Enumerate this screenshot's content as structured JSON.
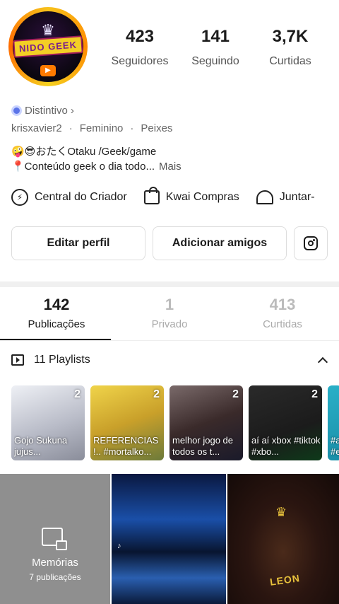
{
  "profile": {
    "avatar_logo_text": "NIDO GEEK",
    "stats": [
      {
        "value": "423",
        "label": "Seguidores"
      },
      {
        "value": "141",
        "label": "Seguindo"
      },
      {
        "value": "3,7K",
        "label": "Curtidas"
      }
    ],
    "badge_label": "Distintivo",
    "badge_chevron": "›",
    "username": "krisxavier2",
    "gender": "Feminino",
    "sign": "Peixes",
    "meta_sep": "·",
    "bio_line1": "🤪😎おたくOtaku /Geek/game",
    "bio_line2": "📍Conteúdo geek o dia todo...",
    "bio_more": "Mais"
  },
  "tools": [
    {
      "label": "Central do Criador",
      "icon": "lightning-icon"
    },
    {
      "label": "Kwai Compras",
      "icon": "shopping-bag-icon"
    },
    {
      "label": "Juntar-",
      "icon": "tent-icon"
    }
  ],
  "buttons": {
    "edit_profile": "Editar perfil",
    "add_friends": "Adicionar amigos"
  },
  "tabs": [
    {
      "count": "142",
      "label": "Publicações",
      "active": true
    },
    {
      "count": "1",
      "label": "Privado",
      "active": false
    },
    {
      "count": "413",
      "label": "Curtidas",
      "active": false
    }
  ],
  "playlists": {
    "header": "11 Playlists",
    "items": [
      {
        "count": "2",
        "title": "Gojo Sukuna jujus...",
        "color": "#d9d9de"
      },
      {
        "count": "2",
        "title": "REFERENCIAS !.. #mortalko...",
        "color": "#c9a02a"
      },
      {
        "count": "2",
        "title": "melhor jogo de todos os t...",
        "color": "#3a2a2a"
      },
      {
        "count": "2",
        "title": "aí aí xbox #tiktok #xbo...",
        "color": "#1b1b1b"
      },
      {
        "count": "",
        "title": "#a #e",
        "color": "#1a8fa8"
      }
    ]
  },
  "grid": {
    "memories_title": "Memórias",
    "memories_sub": "7 publicações",
    "leon_text": "LEON",
    "crown": "♛",
    "tiktok_mark": "♪"
  },
  "colors": {
    "accent": "#1b1b1b",
    "muted": "#aaaaaa",
    "badge": "#5b74e8",
    "avatar_ring": "#f7c21b"
  }
}
